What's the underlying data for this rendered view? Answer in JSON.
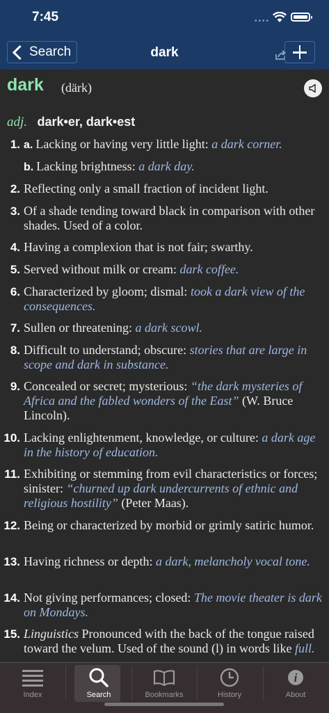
{
  "status": {
    "time": "7:45"
  },
  "navbar": {
    "back_label": "Search",
    "title": "dark"
  },
  "entry": {
    "headword": "dark",
    "pronunciation": "(därk)",
    "pos": "adj.",
    "forms": "dark•er, dark•est",
    "senses": [
      {
        "num": "1.",
        "sub": "a.",
        "text": "Lacking or having very little light: ",
        "ex": "a dark corner."
      },
      {
        "sub": "b.",
        "text": "Lacking brightness: ",
        "ex": "a dark day."
      },
      {
        "num": "2.",
        "text": "Reflecting only a small fraction of incident light."
      },
      {
        "num": "3.",
        "text": "Of a shade tending toward black in comparison with other shades. Used of a color."
      },
      {
        "num": "4.",
        "text": "Having a complexion that is not fair; swarthy."
      },
      {
        "num": "5.",
        "text": "Served without milk or cream: ",
        "ex": "dark coffee."
      },
      {
        "num": "6.",
        "text": "Characterized by gloom; dismal: ",
        "ex": "took a dark view of the consequences."
      },
      {
        "num": "7.",
        "text": "Sullen or threatening: ",
        "ex": "a dark scowl."
      },
      {
        "num": "8.",
        "text": "Difficult to understand; obscure: ",
        "ex": "stories that are large in scope and dark in substance."
      },
      {
        "num": "9.",
        "text": "Concealed or secret; mysterious: ",
        "ex": "“the dark mysteries of Africa and the fabled wonders of the East”",
        "tail": " (W. Bruce Lincoln)."
      },
      {
        "num": "10.",
        "text": "Lacking enlightenment, knowledge, or culture: ",
        "ex": "a dark age in the history of education."
      },
      {
        "num": "11.",
        "text": "Exhibiting or stemming from evil characteristics or forces; sinister: ",
        "ex": "“churned up dark undercurrents of ethnic and religious hostility”",
        "tail": " (Peter Maas)."
      },
      {
        "num": "12.",
        "text": "Being or characterized by morbid or grimly satiric humor."
      },
      {
        "num": "13.",
        "text": "Having richness or depth: ",
        "ex": "a dark, melancholy vocal tone."
      },
      {
        "num": "14.",
        "text": "Not giving performances; closed: ",
        "ex": "The movie theater is dark on Mondays."
      },
      {
        "num": "15.",
        "label": "Linguistics",
        "text": " Pronounced with the back of the tongue raised toward the velum. Used of the sound (l) in words like ",
        "ex": "full."
      }
    ]
  },
  "tabs": [
    {
      "label": "Index",
      "icon": "index-icon"
    },
    {
      "label": "Search",
      "icon": "search-icon",
      "active": true
    },
    {
      "label": "Bookmarks",
      "icon": "bookmarks-icon"
    },
    {
      "label": "History",
      "icon": "history-icon"
    },
    {
      "label": "About",
      "icon": "about-icon"
    }
  ],
  "colors": {
    "nav": "#1b3a66",
    "headword": "#8fe3b0",
    "example": "#9db8e2",
    "background": "#2a2a2a",
    "tabbar": "#362e30"
  }
}
